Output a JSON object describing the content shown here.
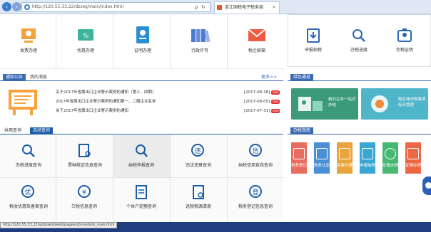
{
  "browser": {
    "url": "http://120.55.33.22/dzswj/main/index.html",
    "search_hint": "ρ",
    "tab_title": "浙江国税电子税务局"
  },
  "top_services": [
    {
      "label": "发票办理",
      "icon": "invoice-icon"
    },
    {
      "label": "优惠办理",
      "icon": "discount-icon"
    },
    {
      "label": "证明办理",
      "icon": "certificate-icon"
    },
    {
      "label": "行政许可",
      "icon": "books-icon"
    },
    {
      "label": "税企邮箱",
      "icon": "mail-icon"
    }
  ],
  "right_services": [
    {
      "label": "申报纳税",
      "icon": "declare-icon"
    },
    {
      "label": "办税进度",
      "icon": "progress-icon"
    },
    {
      "label": "完税证明",
      "icon": "tax-cert-icon"
    }
  ],
  "notices": {
    "tab_active": "通知公告",
    "tab_other": "我的消息",
    "more": "更多>>",
    "items": [
      {
        "title": "关于2017年省属出口企业警示案例的通知（第三、四期）",
        "date": "[2017-08-18]",
        "badge": "new"
      },
      {
        "title": "2017年省属出口企业警示案例的通知第一、二期企业名单",
        "date": "[2017-08-05]",
        "badge": "new"
      },
      {
        "title": "关于2017年省属出口企业警示案例的通知",
        "date": "[2017-07-31]",
        "badge": "new"
      }
    ]
  },
  "green_channel": {
    "title": "绿色通道",
    "tiles": [
      {
        "label": "新办企业一站式办结"
      },
      {
        "label": "跨区域涉税事项综合管理"
      }
    ]
  },
  "query": {
    "tab_other": "共用查询",
    "tab_active": "自然查询",
    "items": [
      {
        "label": "办税进度查询",
        "icon": "search-progress-icon"
      },
      {
        "label": "票种核定信息查询",
        "icon": "ticket-search-icon"
      },
      {
        "label": "纳税申报查询",
        "icon": "declare-search-icon"
      },
      {
        "label": "违法违章查询",
        "icon": "violation-search-icon"
      },
      {
        "label": "纳税信用自我查询",
        "icon": "credit-search-icon"
      },
      {
        "label": "税收优惠及备案查询",
        "icon": "preferential-search-icon"
      },
      {
        "label": "欠税信息查询",
        "icon": "arrears-search-icon"
      },
      {
        "label": "个体户定额查询",
        "icon": "quota-search-icon"
      },
      {
        "label": "逃税税源清册",
        "icon": "evasion-list-icon"
      },
      {
        "label": "税务登记信息查询",
        "icon": "registration-search-icon"
      }
    ]
  },
  "guide": {
    "title": "办税指南",
    "items": [
      {
        "label": "税务登记",
        "color": "#e86c5f"
      },
      {
        "label": "税务认定",
        "color": "#4b8fd6"
      },
      {
        "label": "发票办理",
        "color": "#e9a43c"
      },
      {
        "label": "申报纳税",
        "color": "#3aa6d4"
      },
      {
        "label": "优惠办理",
        "color": "#46b871"
      },
      {
        "label": "证明办理",
        "color": "#ec6845"
      }
    ]
  },
  "status_bar": {
    "link": "http://120.55.33.22/sjdzswjsbweb/pages/sb/nssb/sb_nssb.html"
  },
  "colors": {
    "header_blue": "#3a6ab4",
    "query_blue": "#1d5ca8",
    "green": "#3b9a7a",
    "status_blue": "#1f3c7e"
  }
}
